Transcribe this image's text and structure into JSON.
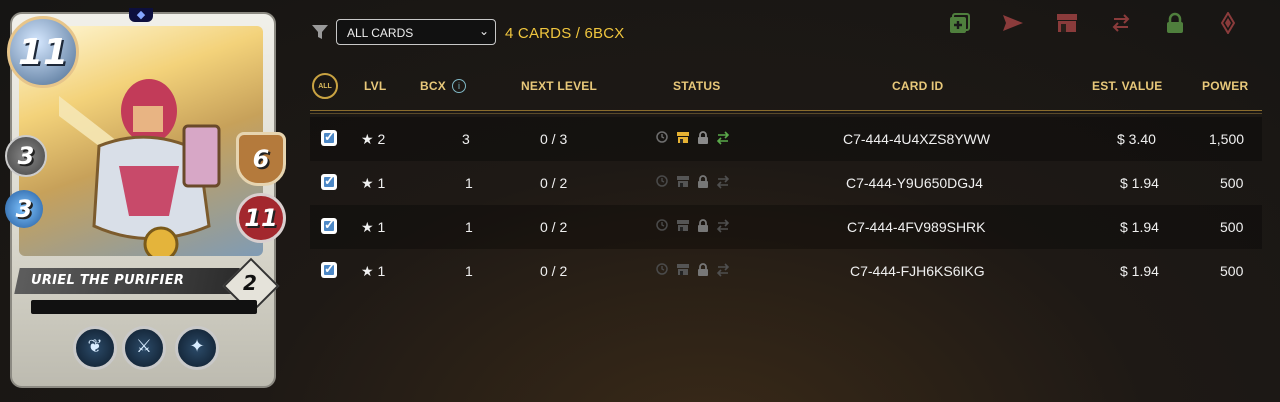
{
  "card": {
    "mana": "11",
    "melee": "3",
    "magic": "3",
    "armor": "6",
    "health": "11",
    "name": "URIEL THE PURIFIER",
    "level": "2",
    "abilities": [
      "wings-icon",
      "shield-slash-icon",
      "sparkle-icon"
    ]
  },
  "toolbar": {
    "filter_value": "ALL CARDS",
    "counts": "4 CARDS / 6BCX",
    "icons": [
      "add-icon",
      "send-icon",
      "market-icon",
      "transfer-icon",
      "lock-icon",
      "burn-icon"
    ],
    "colors": {
      "counts": "#f0c63e",
      "header": "#e8c87a",
      "active_green": "#5aa94a",
      "active_gold": "#e6b233"
    }
  },
  "table": {
    "all_label": "ALL",
    "headers": {
      "lvl": "LVL",
      "bcx": "BCX",
      "next": "NEXT LEVEL",
      "status": "STATUS",
      "card_id": "CARD ID",
      "value": "EST. VALUE",
      "power": "POWER"
    },
    "rows": [
      {
        "lvl": "★ 2",
        "bcx": "3",
        "next": "0 / 3",
        "card_id": "C7-444-4U4XZS8YWW",
        "value": "$ 3.40",
        "power": "1,500",
        "checked": true,
        "status_active": true
      },
      {
        "lvl": "★ 1",
        "bcx": "1",
        "next": "0 / 2",
        "card_id": "C7-444-Y9U650DGJ4",
        "value": "$ 1.94",
        "power": "500",
        "checked": true,
        "status_active": false
      },
      {
        "lvl": "★ 1",
        "bcx": "1",
        "next": "0 / 2",
        "card_id": "C7-444-4FV989SHRK",
        "value": "$ 1.94",
        "power": "500",
        "checked": true,
        "status_active": false
      },
      {
        "lvl": "★ 1",
        "bcx": "1",
        "next": "0 / 2",
        "card_id": "C7-444-FJH6KS6IKG",
        "value": "$ 1.94",
        "power": "500",
        "checked": true,
        "status_active": false
      }
    ]
  }
}
